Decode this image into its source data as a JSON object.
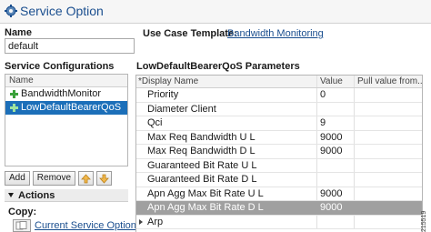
{
  "header": {
    "title": "Service Option"
  },
  "name_field": {
    "label": "Name",
    "value": "default"
  },
  "use_case_template": {
    "label": "Use Case Template:",
    "link_text": "Bandwidth Monitoring"
  },
  "service_configurations": {
    "label": "Service Configurations",
    "column_header": "Name",
    "items": [
      {
        "label": "BandwidthMonitor",
        "selected": false
      },
      {
        "label": "LowDefaultBearerQoS",
        "selected": true
      }
    ],
    "buttons": {
      "add": "Add",
      "remove": "Remove"
    }
  },
  "actions": {
    "title": "Actions",
    "copy_label": "Copy:",
    "copy_link": "Current Service Option"
  },
  "parameters": {
    "title": "LowDefaultBearerQoS Parameters",
    "columns": [
      "*Display Name",
      "Value",
      "Pull value from..."
    ],
    "rows": [
      {
        "name": "Priority",
        "value": "0",
        "pull": ""
      },
      {
        "name": "Diameter Client",
        "value": "",
        "pull": ""
      },
      {
        "name": "Qci",
        "value": "9",
        "pull": ""
      },
      {
        "name": "Max Req Bandwidth U L",
        "value": "9000",
        "pull": ""
      },
      {
        "name": "Max Req Bandwidth D L",
        "value": "9000",
        "pull": ""
      },
      {
        "name": "Guaranteed Bit Rate U L",
        "value": "",
        "pull": ""
      },
      {
        "name": "Guaranteed Bit Rate D L",
        "value": "",
        "pull": ""
      },
      {
        "name": "Apn Agg Max Bit Rate U L",
        "value": "9000",
        "pull": ""
      },
      {
        "name": "Apn Agg Max Bit Rate D L",
        "value": "9000",
        "pull": "",
        "selected": true
      },
      {
        "name": "Arp",
        "value": "",
        "pull": "",
        "expandable": true
      }
    ]
  },
  "figure_id": "215519",
  "colors": {
    "link": "#1b4f8f",
    "selection": "#1c6fb9",
    "row_selection": "#a0a0a0",
    "add_icon": "#3aa13a"
  }
}
